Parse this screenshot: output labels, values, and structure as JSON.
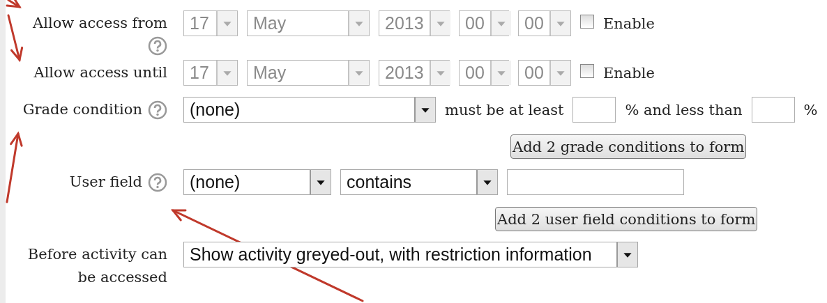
{
  "rows": [
    {
      "kind": "fields",
      "label": "Allow access from",
      "help": true,
      "items": [
        {
          "kind": "select",
          "value": "17",
          "disabled": true
        },
        {
          "kind": "select",
          "value": "May",
          "disabled": true
        },
        {
          "kind": "select",
          "value": "2013",
          "disabled": true
        },
        {
          "kind": "select",
          "value": "00",
          "disabled": true
        },
        {
          "kind": "select",
          "value": "00",
          "disabled": true
        },
        {
          "kind": "checkbox",
          "label": "Enable",
          "checked": false
        }
      ]
    },
    {
      "kind": "fields",
      "label": "Allow access until",
      "help": false,
      "items": [
        {
          "kind": "select",
          "value": "17",
          "disabled": true
        },
        {
          "kind": "select",
          "value": "May",
          "disabled": true
        },
        {
          "kind": "select",
          "value": "2013",
          "disabled": true
        },
        {
          "kind": "select",
          "value": "00",
          "disabled": true
        },
        {
          "kind": "select",
          "value": "00",
          "disabled": true
        },
        {
          "kind": "checkbox",
          "label": "Enable",
          "checked": false
        }
      ]
    },
    {
      "kind": "fields",
      "label": "Grade condition",
      "help": true,
      "items": [
        {
          "kind": "select",
          "value": "(none)",
          "disabled": false
        },
        {
          "kind": "text",
          "text": "must be at least"
        },
        {
          "kind": "input"
        },
        {
          "kind": "text",
          "text": "% and less than"
        },
        {
          "kind": "input"
        },
        {
          "kind": "text",
          "text": "%"
        }
      ]
    },
    {
      "kind": "button",
      "label": "Add 2 grade conditions to form"
    },
    {
      "kind": "fields",
      "label": "User field",
      "help": true,
      "items": [
        {
          "kind": "select",
          "value": "(none)",
          "disabled": false
        },
        {
          "kind": "select",
          "value": "contains",
          "disabled": false
        },
        {
          "kind": "input"
        }
      ]
    },
    {
      "kind": "button",
      "label": "Add 2 user field conditions to form"
    },
    {
      "kind": "fields",
      "label": "Before activity can be accessed",
      "help": false,
      "items": [
        {
          "kind": "select",
          "value": "Show activity greyed-out, with restriction information",
          "disabled": false
        }
      ]
    }
  ]
}
